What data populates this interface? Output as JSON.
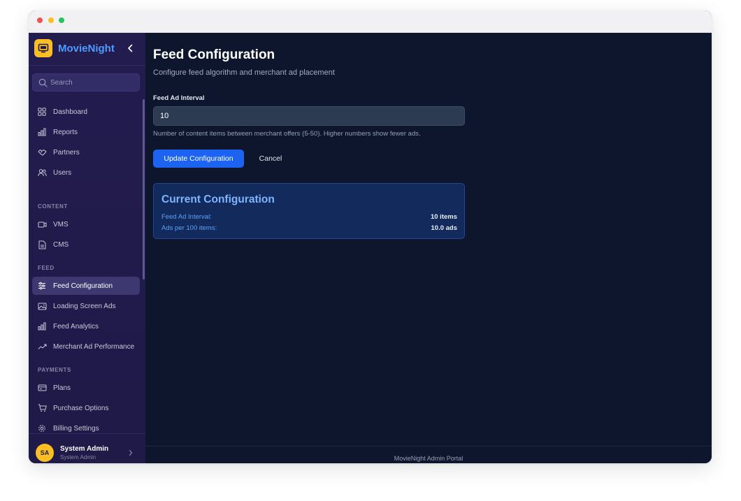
{
  "app": {
    "name": "MovieNight"
  },
  "search": {
    "placeholder": "Search"
  },
  "sidebar": {
    "items": [
      {
        "label": "Dashboard",
        "icon": "grid-icon"
      },
      {
        "label": "Reports",
        "icon": "bar-chart-icon"
      },
      {
        "label": "Partners",
        "icon": "handshake-icon"
      },
      {
        "label": "Users",
        "icon": "users-icon"
      }
    ],
    "sections": [
      {
        "title": "CONTENT",
        "items": [
          {
            "label": "VMS",
            "icon": "video-icon"
          },
          {
            "label": "CMS",
            "icon": "document-icon"
          }
        ]
      },
      {
        "title": "FEED",
        "items": [
          {
            "label": "Feed Configuration",
            "icon": "sliders-icon",
            "active": true
          },
          {
            "label": "Loading Screen Ads",
            "icon": "image-icon"
          },
          {
            "label": "Feed Analytics",
            "icon": "bar-chart-icon"
          },
          {
            "label": "Merchant Ad Performance",
            "icon": "trending-up-icon"
          }
        ]
      },
      {
        "title": "PAYMENTS",
        "items": [
          {
            "label": "Plans",
            "icon": "credit-card-icon"
          },
          {
            "label": "Purchase Options",
            "icon": "cart-icon"
          },
          {
            "label": "Billing Settings",
            "icon": "settings-icon"
          }
        ]
      }
    ]
  },
  "user": {
    "initials": "SA",
    "name": "System Admin",
    "role": "System Admin"
  },
  "page": {
    "title": "Feed Configuration",
    "subtitle": "Configure feed algorithm and merchant ad placement"
  },
  "form": {
    "label": "Feed Ad Interval",
    "value": "10",
    "help": "Number of content items between merchant offers (5-50). Higher numbers show fewer ads.",
    "submit_label": "Update Configuration",
    "cancel_label": "Cancel"
  },
  "current_config": {
    "title": "Current Configuration",
    "rows": [
      {
        "label": "Feed Ad Interval:",
        "value": "10 items"
      },
      {
        "label": "Ads per 100 items:",
        "value": "10.0 ads"
      }
    ]
  },
  "footer": {
    "text": "MovieNight Admin Portal"
  },
  "colors": {
    "accent": "#1d63f2",
    "brand": "#4f9bff",
    "logo": "#fbbf24",
    "sidebar": "#231c4f",
    "main": "#0d162c"
  }
}
